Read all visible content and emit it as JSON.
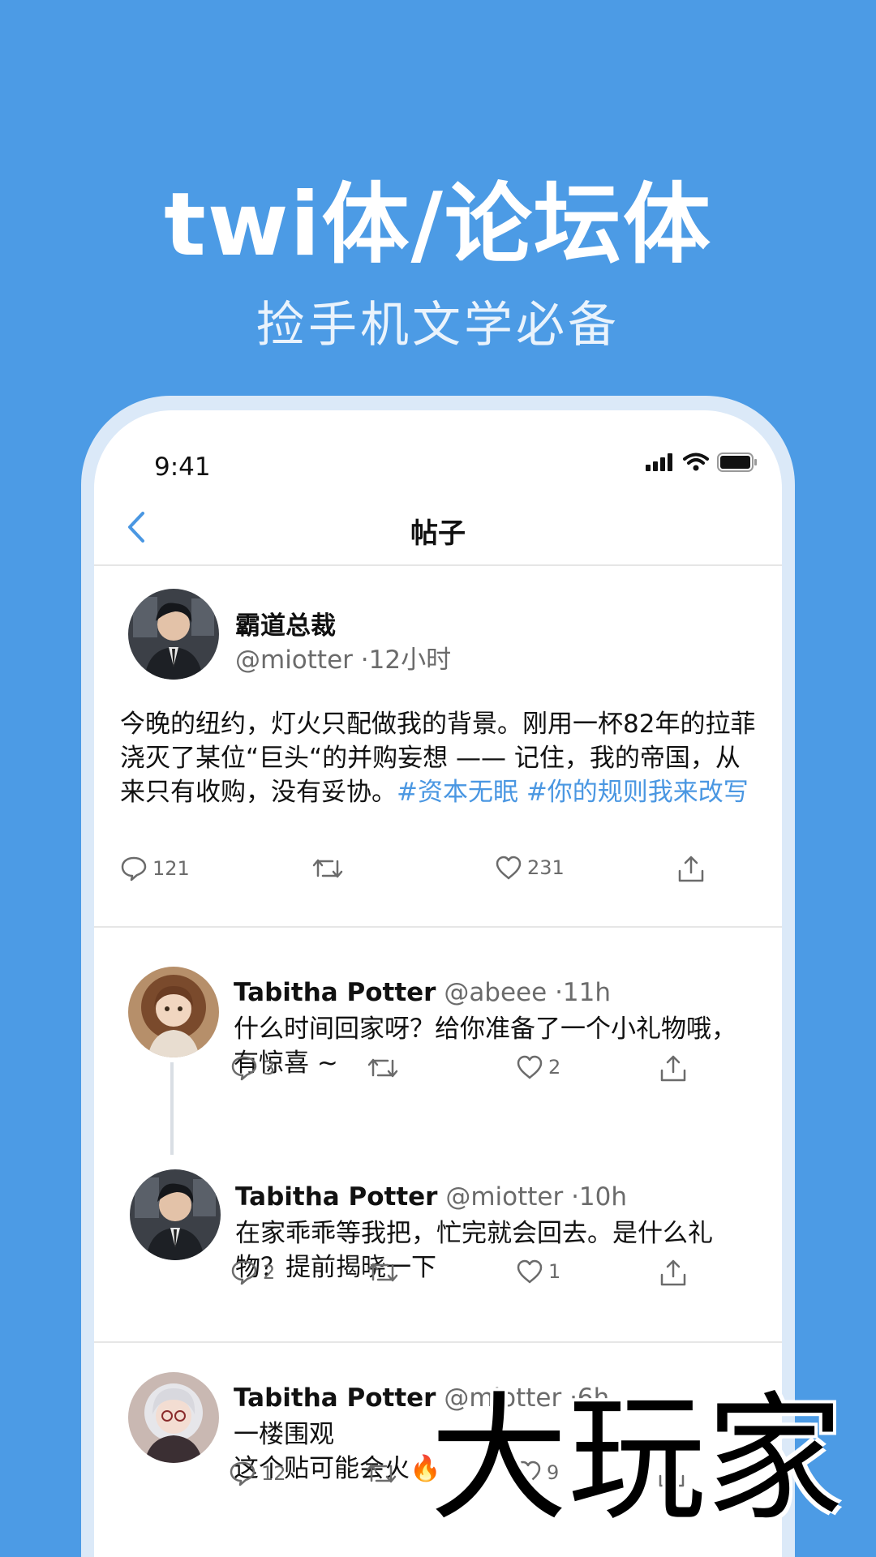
{
  "promo": {
    "headline": "twi体/论坛体",
    "subheadline": "捡手机文学必备"
  },
  "status_bar": {
    "time": "9:41"
  },
  "nav": {
    "title": "帖子"
  },
  "main_post": {
    "name": "霸道总裁",
    "handle": "@miotter",
    "time": "·12小时",
    "text": "今晚的纽约，灯火只配做我的背景。刚用一杯82年的拉菲浇灭了某位“巨头“的并购妄想 —— 记住，我的帝国，从来只有收购，没有妥协。",
    "hashtags": "#资本无眠 #你的规则我来改写",
    "replies": "121",
    "retweets": "",
    "likes": "231"
  },
  "replies": [
    {
      "name": "Tabitha Potter",
      "handle": "@abeee",
      "time": "·11h",
      "text": "什么时间回家呀？给你准备了一个小礼物哦，有惊喜 ~",
      "replies": "3",
      "likes": "2"
    },
    {
      "name": "Tabitha Potter",
      "handle": "@miotter",
      "time": "·10h",
      "text": "在家乖乖等我把，忙完就会回去。是什么礼物？提前揭晓一下",
      "replies": "2",
      "likes": "1"
    },
    {
      "name": "Tabitha Potter",
      "handle": "@miotter",
      "time": "·6h",
      "text": "一楼围观\n这个贴可能会火🔥",
      "replies": "12",
      "likes": "9"
    }
  ],
  "watermark": "大玩家",
  "colors": {
    "background": "#4c9be5",
    "hashtag": "#4a97e2",
    "nav_back": "#4a97e2"
  }
}
